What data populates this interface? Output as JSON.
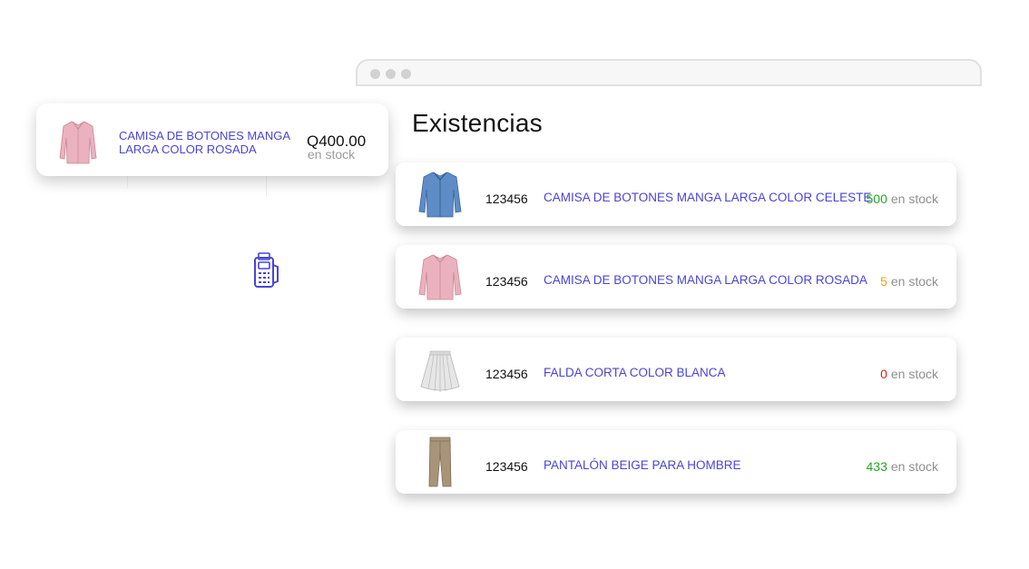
{
  "window": {
    "dots": 3
  },
  "page_title": "Existencias",
  "pos": {
    "product_name": "CAMISA DE BOTONES MANGA LARGA COLOR ROSADA",
    "price": "Q400.00",
    "stock_label": "en stock",
    "thumbnail": "pink-shirt-image"
  },
  "terminal_icon": "payment-terminal-icon",
  "colors": {
    "accent": "#4a44d6",
    "in_stock": "#22a722",
    "low_stock": "#e8a317",
    "out_of_stock": "#d9241b"
  },
  "inventory": [
    {
      "code": "123456",
      "name": "CAMISA DE BOTONES MANGA LARGA COLOR CELESTE",
      "qty": "500",
      "qty_color": "#22a722",
      "stock_label": "en stock",
      "thumbnail": "blue-shirt-image"
    },
    {
      "code": "123456",
      "name": "CAMISA DE BOTONES MANGA LARGA COLOR ROSADA",
      "qty": "5",
      "qty_color": "#e8a317",
      "stock_label": "en stock",
      "thumbnail": "pink-shirt-image"
    },
    {
      "code": "123456",
      "name": "FALDA CORTA COLOR BLANCA",
      "qty": "0",
      "qty_color": "#d9241b",
      "stock_label": "en stock",
      "thumbnail": "white-skirt-image"
    },
    {
      "code": "123456",
      "name": "PANTALÓN BEIGE PARA HOMBRE",
      "qty": "433",
      "qty_color": "#22a722",
      "stock_label": "en stock",
      "thumbnail": "beige-pants-image"
    }
  ]
}
